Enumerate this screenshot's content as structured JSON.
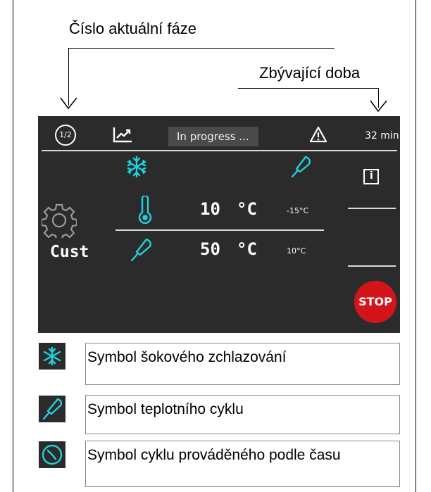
{
  "callouts": {
    "phase_number": "Číslo aktuální fáze",
    "remaining_time": "Zbývající doba"
  },
  "screen": {
    "phase_indicator": "1/2",
    "status": "In progress ...",
    "time_left": "32 min",
    "program_name": "Cust",
    "chamber_temp_value": "10",
    "chamber_temp_unit": "°C",
    "chamber_temp_setpoint": "-15°C",
    "probe_temp_value": "50",
    "probe_temp_unit": "°C",
    "probe_temp_setpoint": "10°C",
    "stop_label": "STOP"
  },
  "legend": [
    {
      "icon": "snowflake-icon",
      "text": "Symbol šokového zchlazování"
    },
    {
      "icon": "probe-icon",
      "text": "Symbol teplotního cyklu"
    },
    {
      "icon": "clock-icon",
      "text": "Symbol cyklu prováděného podle času"
    }
  ],
  "colors": {
    "screen_bg": "#2b2b2b",
    "accent_cyan": "#1fd1e0",
    "stop_red": "#d4141b"
  }
}
